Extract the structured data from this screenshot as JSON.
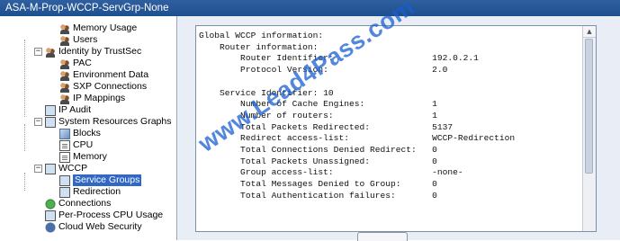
{
  "window": {
    "title": "ASA-M-Prop-WCCP-ServGrp-None"
  },
  "tree": {
    "items": [
      {
        "label": "Memory Usage",
        "icon": "users-icon"
      },
      {
        "label": "Users",
        "icon": "users-icon"
      },
      {
        "label": "Identity by TrustSec",
        "icon": "users-icon",
        "expander": "−"
      },
      {
        "label": "PAC",
        "icon": "users-icon"
      },
      {
        "label": "Environment Data",
        "icon": "users-icon"
      },
      {
        "label": "SXP Connections",
        "icon": "users-icon"
      },
      {
        "label": "IP Mappings",
        "icon": "users-icon"
      },
      {
        "label": "IP Audit",
        "icon": "monitor-icon"
      },
      {
        "label": "System Resources Graphs",
        "icon": "monitor-icon",
        "expander": "−"
      },
      {
        "label": "Blocks",
        "icon": "block-icon"
      },
      {
        "label": "CPU",
        "icon": "doc-icon"
      },
      {
        "label": "Memory",
        "icon": "doc-icon"
      },
      {
        "label": "WCCP",
        "icon": "monitor-icon",
        "expander": "−"
      },
      {
        "label": "Service Groups",
        "icon": "monitor-icon",
        "selected": true
      },
      {
        "label": "Redirection",
        "icon": "monitor-icon"
      },
      {
        "label": "Connections",
        "icon": "monitor-icon"
      },
      {
        "label": "Per-Process CPU Usage",
        "icon": "monitor-icon"
      },
      {
        "label": "Cloud Web Security",
        "icon": "cloud-icon"
      }
    ]
  },
  "output": {
    "lines": [
      "Global WCCP information:",
      "    Router information:",
      "        Router Identifier:                   192.0.2.1",
      "        Protocol Version:                    2.0",
      "",
      "    Service Identifier: 10",
      "        Number of Cache Engines:             1",
      "        Number of routers:                   1",
      "        Total Packets Redirected:            5137",
      "        Redirect access-list:                WCCP-Redirection",
      "        Total Connections Denied Redirect:   0",
      "        Total Packets Unassigned:            0",
      "        Group access-list:                   -none-",
      "        Total Messages Denied to Group:      0",
      "        Total Authentication failures:       0"
    ]
  },
  "watermark": "www.Lead4Pass.com",
  "colors": {
    "titlebar": "#1e4f8f",
    "selection": "#3168c6",
    "watermark": "#195fd2"
  }
}
